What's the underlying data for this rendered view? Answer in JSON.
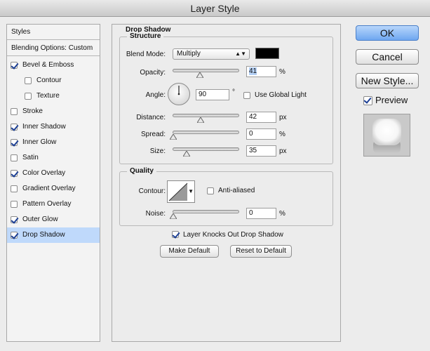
{
  "window": {
    "title": "Layer Style"
  },
  "styles_list": {
    "header": "Styles",
    "blending_options": "Blending Options: Custom",
    "items": [
      {
        "label": "Bevel & Emboss",
        "checked": true,
        "indent": false,
        "selected": false
      },
      {
        "label": "Contour",
        "checked": false,
        "indent": true,
        "selected": false
      },
      {
        "label": "Texture",
        "checked": false,
        "indent": true,
        "selected": false
      },
      {
        "label": "Stroke",
        "checked": false,
        "indent": false,
        "selected": false
      },
      {
        "label": "Inner Shadow",
        "checked": true,
        "indent": false,
        "selected": false
      },
      {
        "label": "Inner Glow",
        "checked": true,
        "indent": false,
        "selected": false
      },
      {
        "label": "Satin",
        "checked": false,
        "indent": false,
        "selected": false
      },
      {
        "label": "Color Overlay",
        "checked": true,
        "indent": false,
        "selected": false
      },
      {
        "label": "Gradient Overlay",
        "checked": false,
        "indent": false,
        "selected": false
      },
      {
        "label": "Pattern Overlay",
        "checked": false,
        "indent": false,
        "selected": false
      },
      {
        "label": "Outer Glow",
        "checked": true,
        "indent": false,
        "selected": false
      },
      {
        "label": "Drop Shadow",
        "checked": true,
        "indent": false,
        "selected": true
      }
    ]
  },
  "drop_shadow": {
    "title": "Drop Shadow",
    "structure": {
      "legend": "Structure",
      "blend_mode_label": "Blend Mode:",
      "blend_mode_value": "Multiply",
      "shadow_color": "#000000",
      "opacity_label": "Opacity:",
      "opacity_value": "41",
      "opacity_unit": "%",
      "opacity_fraction": 0.41,
      "angle_label": "Angle:",
      "angle_value": "90",
      "angle_unit": "°",
      "use_global_light_label": "Use Global Light",
      "use_global_light_checked": false,
      "distance_label": "Distance:",
      "distance_value": "42",
      "distance_unit": "px",
      "distance_fraction": 0.42,
      "spread_label": "Spread:",
      "spread_value": "0",
      "spread_unit": "%",
      "spread_fraction": 0.0,
      "size_label": "Size:",
      "size_value": "35",
      "size_unit": "px",
      "size_fraction": 0.2
    },
    "quality": {
      "legend": "Quality",
      "contour_label": "Contour:",
      "anti_aliased_label": "Anti-aliased",
      "anti_aliased_checked": false,
      "noise_label": "Noise:",
      "noise_value": "0",
      "noise_unit": "%",
      "noise_fraction": 0.0
    },
    "knockout_label": "Layer Knocks Out Drop Shadow",
    "knockout_checked": true,
    "make_default_label": "Make Default",
    "reset_default_label": "Reset to Default"
  },
  "actions": {
    "ok_label": "OK",
    "cancel_label": "Cancel",
    "new_style_label": "New Style...",
    "preview_label": "Preview",
    "preview_checked": true
  },
  "colors": {
    "primary_button": "#6ea7f0",
    "selection_highlight": "#bfd9fb",
    "checkmark": "#1c3f94"
  }
}
